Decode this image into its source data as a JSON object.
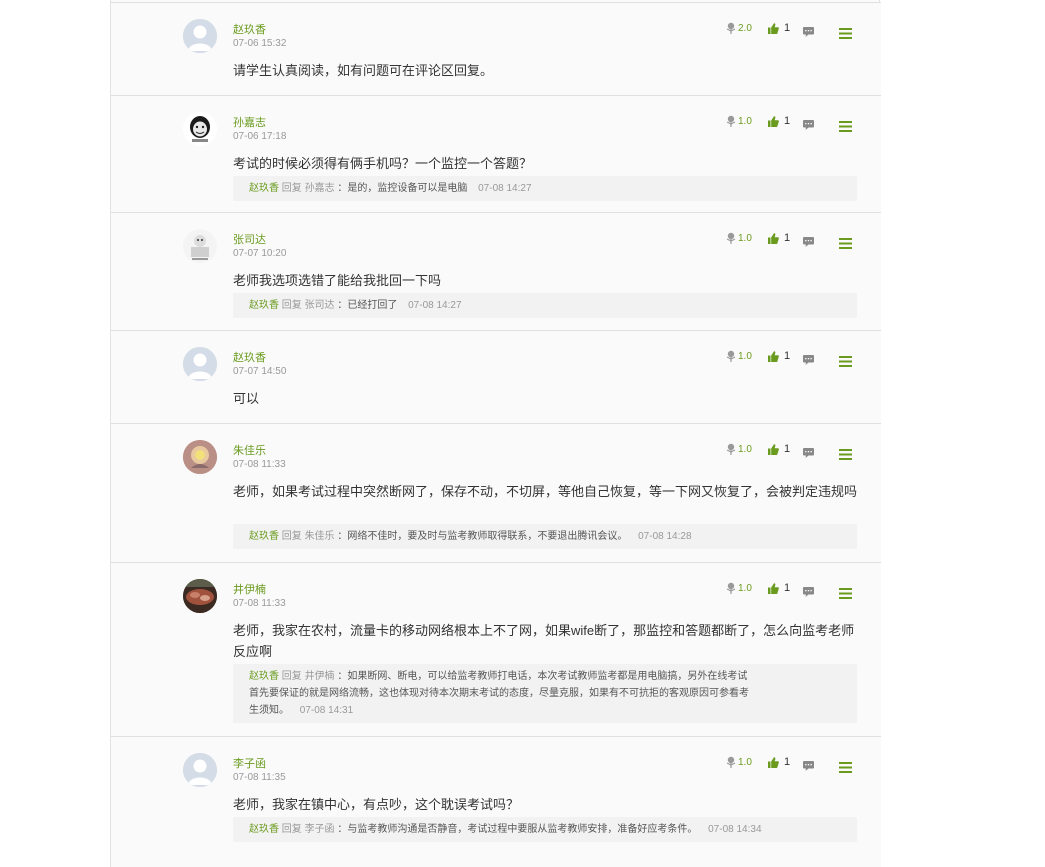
{
  "comments": [
    {
      "user": "赵玖香",
      "time": "07-06 15:32",
      "text": "请学生认真阅读，如有问题可在评论区回复。",
      "score": "2.0",
      "likes": "1",
      "avatar": "default-avatar",
      "reply": null
    },
    {
      "user": "孙嘉志",
      "time": "07-06 17:18",
      "text": "考试的时候必须得有俩手机吗？一个监控一个答题？",
      "score": "1.0",
      "likes": "1",
      "avatar": "meme-face-avatar",
      "reply": {
        "replier": "赵玖香",
        "word": "回复",
        "target": "孙嘉志",
        "sep": "：",
        "text": "是的，监控设备可以是电脑",
        "time": "07-08 14:27"
      }
    },
    {
      "user": "张司达",
      "time": "07-07 10:20",
      "text": "老师我选项选错了能给我批回一下吗",
      "score": "1.0",
      "likes": "1",
      "avatar": "meme-figure-avatar",
      "reply": {
        "replier": "赵玖香",
        "word": "回复",
        "target": "张司达",
        "sep": "：",
        "text": "已经打回了",
        "time": "07-08 14:27"
      }
    },
    {
      "user": "赵玖香",
      "time": "07-07 14:50",
      "text": "可以",
      "score": "1.0",
      "likes": "1",
      "avatar": "default-avatar",
      "reply": null
    },
    {
      "user": "朱佳乐",
      "time": "07-08 11:33",
      "text": "老师，如果考试过程中突然断网了，保存不动，不切屏，等他自己恢复，等一下网又恢复了，会被判定违规吗",
      "score": "1.0",
      "likes": "1",
      "avatar": "photo-avatar",
      "reply": {
        "replier": "赵玖香",
        "word": "回复",
        "target": "朱佳乐",
        "sep": "：",
        "text": "网络不佳时，要及时与监考教师取得联系，不要退出腾讯会议。",
        "time": "07-08 14:28"
      }
    },
    {
      "user": "井伊楠",
      "time": "07-08 11:33",
      "text": "老师，我家在农村，流量卡的移动网络根本上不了网，如果wife断了，那监控和答题都断了，怎么向监考老师反应啊",
      "score": "1.0",
      "likes": "1",
      "avatar": "food-photo-avatar",
      "reply": {
        "replier": "赵玖香",
        "word": "回复",
        "target": "井伊楠",
        "sep": "：",
        "text": "如果断网、断电，可以给监考教师打电话，本次考试教师监考都是用电脑搞，另外在线考试首先要保证的就是网络流畅，这也体现对待本次期末考试的态度，尽量克服，如果有不可抗拒的客观原因可参看考生须知。",
        "time": "07-08 14:31"
      }
    },
    {
      "user": "李子函",
      "time": "07-08 11:35",
      "text": "老师，我家在镇中心，有点吵，这个耽误考试吗？",
      "score": "1.0",
      "likes": "1",
      "avatar": "default-avatar",
      "reply": {
        "replier": "赵玖香",
        "word": "回复",
        "target": "李子函",
        "sep": "：",
        "text": "与监考教师沟通是否静音，考试过程中要服从监考教师安排，准备好应考条件。",
        "time": "07-08 14:34"
      }
    }
  ],
  "icons": {
    "score": "flower-icon",
    "like": "thumbs-up-icon",
    "message": "message-icon",
    "menu": "menu-icon"
  },
  "colors": {
    "accent": "#6a9b1f",
    "panel_bg": "#fafafa",
    "reply_bg": "#f2f2f2"
  }
}
